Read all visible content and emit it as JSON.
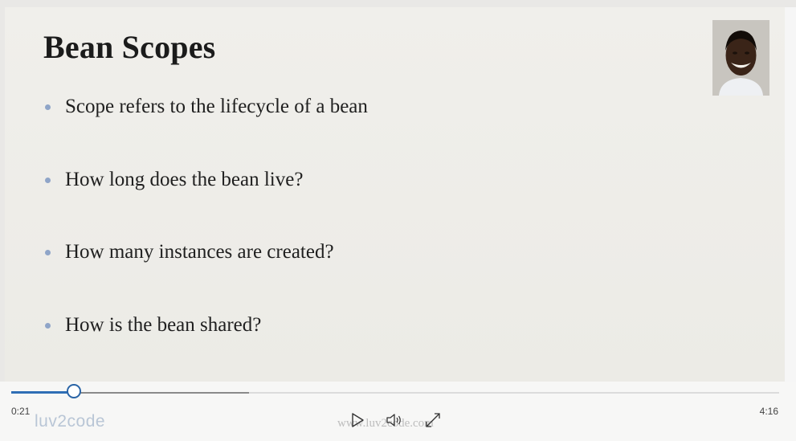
{
  "slide": {
    "title": "Bean Scopes",
    "bullets": [
      "Scope refers to the lifecycle of a bean",
      "How long does the bean live?",
      "How many instances are created?",
      "How is the bean shared?"
    ]
  },
  "player": {
    "current_time": "0:21",
    "duration": "4:16",
    "played_fraction": 0.082,
    "buffered_fraction": 0.31,
    "logo_text": "luv2code",
    "watermark": "www.luv2code.com",
    "controls": [
      "play-icon",
      "volume-icon",
      "fullscreen-icon"
    ]
  },
  "colors": {
    "accent": "#2f6eb5",
    "bullet": "#8fa5c8",
    "slide_bg": "#eeede9"
  }
}
